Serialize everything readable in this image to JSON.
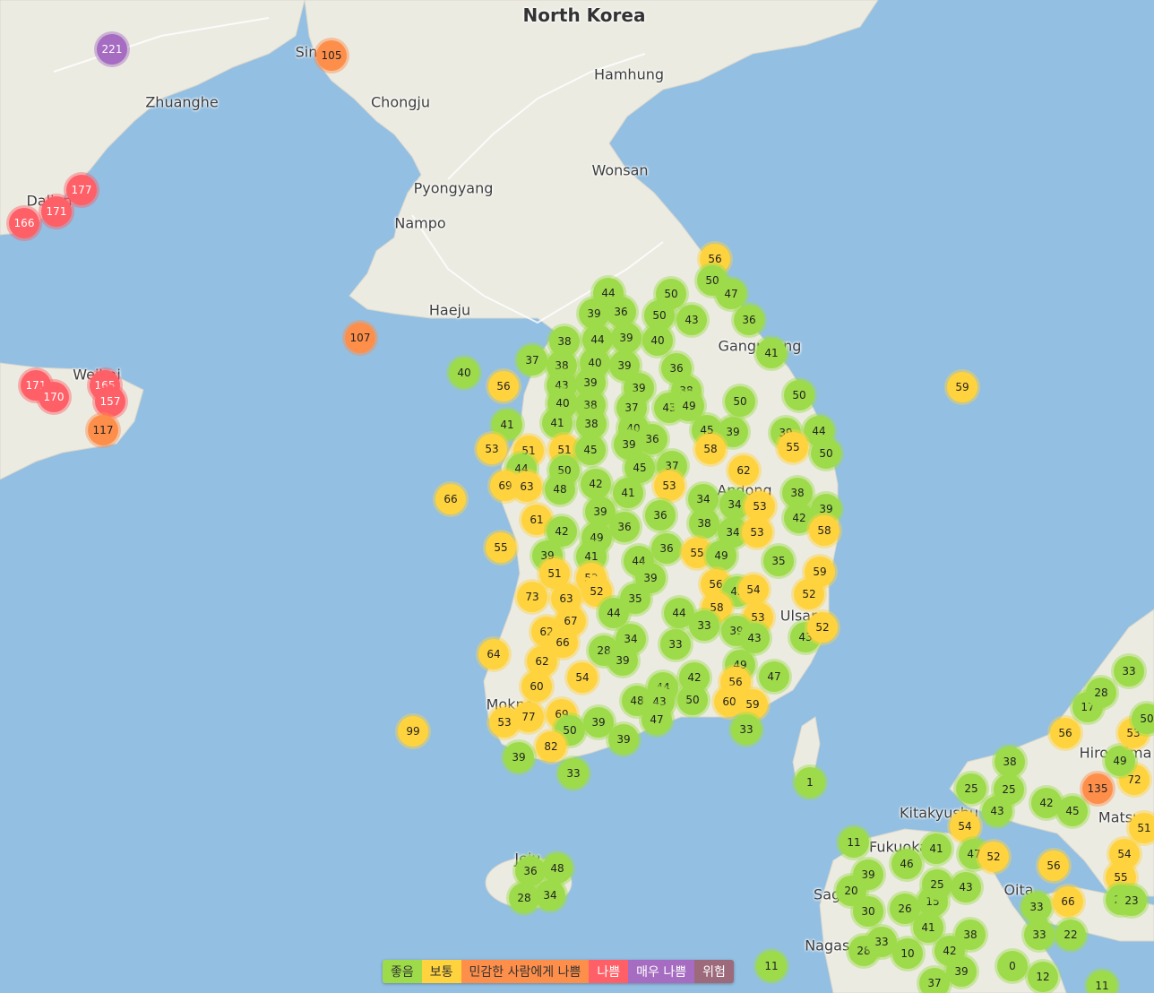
{
  "colors": {
    "sea": "#93bfe2",
    "land": "#ecebe2",
    "good": "#9ddb4a",
    "moderate": "#ffd33e",
    "sensitive": "#fe8f4b",
    "unhealthy": "#ff5f67",
    "very_unhealthy": "#a56cc2",
    "hazardous": "#9d6a7c"
  },
  "labels": [
    {
      "text": "North Korea"
    },
    {
      "text": "Sin"
    },
    {
      "text": "Hamhung"
    },
    {
      "text": "Zhuanghe"
    },
    {
      "text": "Chongju"
    },
    {
      "text": "Wonsan"
    },
    {
      "text": "Pyongyang"
    },
    {
      "text": "Dalian"
    },
    {
      "text": "Nampo"
    },
    {
      "text": "Haeju"
    },
    {
      "text": "Gangneung"
    },
    {
      "text": "Weihai"
    },
    {
      "text": "Andong"
    },
    {
      "text": "Ulsan"
    },
    {
      "text": "Mokpo"
    },
    {
      "text": "Jeju"
    },
    {
      "text": "Hiroshima"
    },
    {
      "text": "Matsue"
    },
    {
      "text": "Kitakyushu"
    },
    {
      "text": "Fukuoka"
    },
    {
      "text": "Saga"
    },
    {
      "text": "Oita"
    },
    {
      "text": "Nagasaki"
    }
  ],
  "stations": [
    {
      "v": "221",
      "c": "p"
    },
    {
      "v": "105",
      "c": "o"
    },
    {
      "v": "177",
      "c": "r"
    },
    {
      "v": "171",
      "c": "r"
    },
    {
      "v": "166",
      "c": "r"
    },
    {
      "v": "107",
      "c": "o"
    },
    {
      "v": "171",
      "c": "r"
    },
    {
      "v": "170",
      "c": "r"
    },
    {
      "v": "165",
      "c": "r"
    },
    {
      "v": "157",
      "c": "r"
    },
    {
      "v": "117",
      "c": "o"
    },
    {
      "v": "56",
      "c": "y"
    },
    {
      "v": "50",
      "c": "g"
    },
    {
      "v": "47",
      "c": "g"
    },
    {
      "v": "44",
      "c": "g"
    },
    {
      "v": "50",
      "c": "g"
    },
    {
      "v": "39",
      "c": "g"
    },
    {
      "v": "36",
      "c": "g"
    },
    {
      "v": "50",
      "c": "g"
    },
    {
      "v": "43",
      "c": "g"
    },
    {
      "v": "36",
      "c": "g"
    },
    {
      "v": "38",
      "c": "g"
    },
    {
      "v": "44",
      "c": "g"
    },
    {
      "v": "39",
      "c": "g"
    },
    {
      "v": "40",
      "c": "g"
    },
    {
      "v": "41",
      "c": "g"
    },
    {
      "v": "37",
      "c": "g"
    },
    {
      "v": "38",
      "c": "g"
    },
    {
      "v": "40",
      "c": "g"
    },
    {
      "v": "39",
      "c": "g"
    },
    {
      "v": "36",
      "c": "g"
    },
    {
      "v": "40",
      "c": "g"
    },
    {
      "v": "56",
      "c": "y"
    },
    {
      "v": "43",
      "c": "g"
    },
    {
      "v": "39",
      "c": "g"
    },
    {
      "v": "39",
      "c": "g"
    },
    {
      "v": "38",
      "c": "g"
    },
    {
      "v": "50",
      "c": "g"
    },
    {
      "v": "50",
      "c": "g"
    },
    {
      "v": "59",
      "c": "y"
    },
    {
      "v": "40",
      "c": "g"
    },
    {
      "v": "38",
      "c": "g"
    },
    {
      "v": "37",
      "c": "g"
    },
    {
      "v": "43",
      "c": "g"
    },
    {
      "v": "49",
      "c": "g"
    },
    {
      "v": "41",
      "c": "g"
    },
    {
      "v": "41",
      "c": "g"
    },
    {
      "v": "38",
      "c": "g"
    },
    {
      "v": "40",
      "c": "g"
    },
    {
      "v": "36",
      "c": "g"
    },
    {
      "v": "45",
      "c": "g"
    },
    {
      "v": "39",
      "c": "g"
    },
    {
      "v": "39",
      "c": "g"
    },
    {
      "v": "44",
      "c": "g"
    },
    {
      "v": "53",
      "c": "y"
    },
    {
      "v": "51",
      "c": "y"
    },
    {
      "v": "51",
      "c": "y"
    },
    {
      "v": "45",
      "c": "g"
    },
    {
      "v": "39",
      "c": "g"
    },
    {
      "v": "58",
      "c": "y"
    },
    {
      "v": "55",
      "c": "y"
    },
    {
      "v": "50",
      "c": "g"
    },
    {
      "v": "44",
      "c": "g"
    },
    {
      "v": "50",
      "c": "g"
    },
    {
      "v": "45",
      "c": "g"
    },
    {
      "v": "37",
      "c": "g"
    },
    {
      "v": "62",
      "c": "y"
    },
    {
      "v": "69",
      "c": "y"
    },
    {
      "v": "63",
      "c": "y"
    },
    {
      "v": "48",
      "c": "g"
    },
    {
      "v": "42",
      "c": "g"
    },
    {
      "v": "41",
      "c": "g"
    },
    {
      "v": "53",
      "c": "y"
    },
    {
      "v": "38",
      "c": "g"
    },
    {
      "v": "66",
      "c": "y"
    },
    {
      "v": "34",
      "c": "g"
    },
    {
      "v": "34",
      "c": "g"
    },
    {
      "v": "53",
      "c": "y"
    },
    {
      "v": "39",
      "c": "g"
    },
    {
      "v": "61",
      "c": "y"
    },
    {
      "v": "42",
      "c": "g"
    },
    {
      "v": "39",
      "c": "g"
    },
    {
      "v": "36",
      "c": "g"
    },
    {
      "v": "36",
      "c": "g"
    },
    {
      "v": "38",
      "c": "g"
    },
    {
      "v": "34",
      "c": "g"
    },
    {
      "v": "53",
      "c": "y"
    },
    {
      "v": "42",
      "c": "g"
    },
    {
      "v": "58",
      "c": "y"
    },
    {
      "v": "55",
      "c": "y"
    },
    {
      "v": "49",
      "c": "g"
    },
    {
      "v": "39",
      "c": "g"
    },
    {
      "v": "41",
      "c": "g"
    },
    {
      "v": "36",
      "c": "g"
    },
    {
      "v": "55",
      "c": "y"
    },
    {
      "v": "49",
      "c": "g"
    },
    {
      "v": "35",
      "c": "g"
    },
    {
      "v": "51",
      "c": "y"
    },
    {
      "v": "52",
      "c": "y"
    },
    {
      "v": "44",
      "c": "g"
    },
    {
      "v": "39",
      "c": "g"
    },
    {
      "v": "59",
      "c": "y"
    },
    {
      "v": "73",
      "c": "y"
    },
    {
      "v": "63",
      "c": "y"
    },
    {
      "v": "52",
      "c": "y"
    },
    {
      "v": "35",
      "c": "g"
    },
    {
      "v": "56",
      "c": "y"
    },
    {
      "v": "42",
      "c": "g"
    },
    {
      "v": "54",
      "c": "y"
    },
    {
      "v": "52",
      "c": "y"
    },
    {
      "v": "67",
      "c": "y"
    },
    {
      "v": "44",
      "c": "g"
    },
    {
      "v": "44",
      "c": "g"
    },
    {
      "v": "58",
      "c": "y"
    },
    {
      "v": "53",
      "c": "y"
    },
    {
      "v": "62",
      "c": "y"
    },
    {
      "v": "66",
      "c": "y"
    },
    {
      "v": "34",
      "c": "g"
    },
    {
      "v": "28",
      "c": "g"
    },
    {
      "v": "33",
      "c": "g"
    },
    {
      "v": "33",
      "c": "g"
    },
    {
      "v": "39",
      "c": "g"
    },
    {
      "v": "43",
      "c": "g"
    },
    {
      "v": "43",
      "c": "g"
    },
    {
      "v": "52",
      "c": "y"
    },
    {
      "v": "64",
      "c": "y"
    },
    {
      "v": "62",
      "c": "y"
    },
    {
      "v": "39",
      "c": "g"
    },
    {
      "v": "54",
      "c": "y"
    },
    {
      "v": "42",
      "c": "g"
    },
    {
      "v": "49",
      "c": "g"
    },
    {
      "v": "47",
      "c": "g"
    },
    {
      "v": "56",
      "c": "y"
    },
    {
      "v": "60",
      "c": "y"
    },
    {
      "v": "44",
      "c": "g"
    },
    {
      "v": "48",
      "c": "g"
    },
    {
      "v": "43",
      "c": "g"
    },
    {
      "v": "50",
      "c": "g"
    },
    {
      "v": "60",
      "c": "y"
    },
    {
      "v": "59",
      "c": "y"
    },
    {
      "v": "53",
      "c": "y"
    },
    {
      "v": "77",
      "c": "y"
    },
    {
      "v": "69",
      "c": "y"
    },
    {
      "v": "50",
      "c": "g"
    },
    {
      "v": "39",
      "c": "g"
    },
    {
      "v": "47",
      "c": "g"
    },
    {
      "v": "39",
      "c": "g"
    },
    {
      "v": "33",
      "c": "g"
    },
    {
      "v": "99",
      "c": "y"
    },
    {
      "v": "82",
      "c": "y"
    },
    {
      "v": "39",
      "c": "g"
    },
    {
      "v": "33",
      "c": "g"
    },
    {
      "v": "1",
      "c": "g"
    },
    {
      "v": "36",
      "c": "g"
    },
    {
      "v": "48",
      "c": "g"
    },
    {
      "v": "28",
      "c": "g"
    },
    {
      "v": "34",
      "c": "g"
    },
    {
      "v": "11",
      "c": "g"
    },
    {
      "v": "38",
      "c": "g"
    },
    {
      "v": "25",
      "c": "g"
    },
    {
      "v": "25",
      "c": "g"
    },
    {
      "v": "43",
      "c": "g"
    },
    {
      "v": "54",
      "c": "y"
    },
    {
      "v": "42",
      "c": "g"
    },
    {
      "v": "45",
      "c": "g"
    },
    {
      "v": "135",
      "c": "o"
    },
    {
      "v": "72",
      "c": "y"
    },
    {
      "v": "49",
      "c": "g"
    },
    {
      "v": "53",
      "c": "y"
    },
    {
      "v": "56",
      "c": "y"
    },
    {
      "v": "17",
      "c": "g"
    },
    {
      "v": "28",
      "c": "g"
    },
    {
      "v": "33",
      "c": "g"
    },
    {
      "v": "50",
      "c": "g"
    },
    {
      "v": "54",
      "c": "y"
    },
    {
      "v": "51",
      "c": "y"
    },
    {
      "v": "11",
      "c": "g"
    },
    {
      "v": "41",
      "c": "g"
    },
    {
      "v": "47",
      "c": "g"
    },
    {
      "v": "52",
      "c": "y"
    },
    {
      "v": "56",
      "c": "y"
    },
    {
      "v": "39",
      "c": "g"
    },
    {
      "v": "46",
      "c": "g"
    },
    {
      "v": "20",
      "c": "g"
    },
    {
      "v": "30",
      "c": "g"
    },
    {
      "v": "26",
      "c": "g"
    },
    {
      "v": "15",
      "c": "g"
    },
    {
      "v": "25",
      "c": "g"
    },
    {
      "v": "43",
      "c": "g"
    },
    {
      "v": "33",
      "c": "g"
    },
    {
      "v": "66",
      "c": "y"
    },
    {
      "v": "55",
      "c": "y"
    },
    {
      "v": "22",
      "c": "g"
    },
    {
      "v": "23",
      "c": "g"
    },
    {
      "v": "28",
      "c": "g"
    },
    {
      "v": "33",
      "c": "g"
    },
    {
      "v": "10",
      "c": "g"
    },
    {
      "v": "41",
      "c": "g"
    },
    {
      "v": "38",
      "c": "g"
    },
    {
      "v": "33",
      "c": "g"
    },
    {
      "v": "22",
      "c": "g"
    },
    {
      "v": "42",
      "c": "g"
    },
    {
      "v": "39",
      "c": "g"
    },
    {
      "v": "37",
      "c": "g"
    },
    {
      "v": "0",
      "c": "g"
    },
    {
      "v": "12",
      "c": "g"
    },
    {
      "v": "11",
      "c": "g"
    }
  ],
  "legend": [
    {
      "label": "좋음",
      "color": "#9ddb4a"
    },
    {
      "label": "보통",
      "color": "#ffd33e"
    },
    {
      "label": "민감한 사람에게 나쁨",
      "color": "#fe8f4b"
    },
    {
      "label": "나쁨",
      "color": "#ff5f67"
    },
    {
      "label": "매우 나쁨",
      "color": "#a56cc2"
    },
    {
      "label": "위험",
      "color": "#9d6a7c"
    }
  ]
}
